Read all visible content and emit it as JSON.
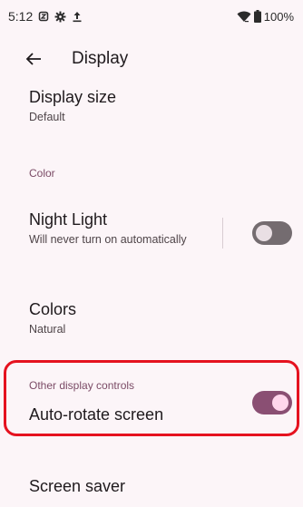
{
  "status_bar": {
    "time": "5:12",
    "icons": [
      "sim-icon",
      "gear-icon",
      "upload-icon"
    ],
    "battery": "100%"
  },
  "app_bar": {
    "title": "Display"
  },
  "prefs": {
    "display_size": {
      "title": "Display size",
      "summary": "Default"
    },
    "color_category": "Color",
    "night_light": {
      "title": "Night Light",
      "summary": "Will never turn on automatically",
      "enabled": false
    },
    "colors": {
      "title": "Colors",
      "summary": "Natural"
    },
    "other_category": "Other display controls",
    "auto_rotate": {
      "title": "Auto-rotate screen",
      "enabled": true
    },
    "screen_saver": {
      "title": "Screen saver"
    }
  },
  "colors": {
    "accent": "#8a4f73",
    "highlight": "#e5121f",
    "background": "#fcf5f8"
  }
}
